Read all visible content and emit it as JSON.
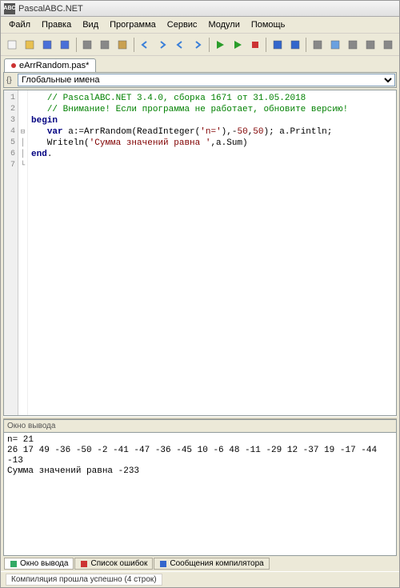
{
  "app": {
    "title": "PascalABC.NET",
    "icon_label": "ABC"
  },
  "menu": [
    "Файл",
    "Правка",
    "Вид",
    "Программа",
    "Сервис",
    "Модули",
    "Помощь"
  ],
  "tab": {
    "label": "eArrRandom.pas*"
  },
  "dropdown": {
    "selected": "Глобальные имена"
  },
  "code": {
    "line_count": 7,
    "lines": [
      {
        "n": 1,
        "fold": "",
        "segs": [
          {
            "t": "   ",
            "c": ""
          },
          {
            "t": "// PascalABC.NET 3.4.0, сборка 1671 от 31.05.2018",
            "c": "c-comment"
          }
        ]
      },
      {
        "n": 2,
        "fold": "",
        "segs": [
          {
            "t": "   ",
            "c": ""
          },
          {
            "t": "// Внимание! Если программа не работает, обновите версию!",
            "c": "c-comment"
          }
        ]
      },
      {
        "n": 3,
        "fold": "",
        "segs": [
          {
            "t": "",
            "c": ""
          }
        ]
      },
      {
        "n": 4,
        "fold": "⊟",
        "segs": [
          {
            "t": "begin",
            "c": "c-key"
          }
        ]
      },
      {
        "n": 5,
        "fold": "│",
        "segs": [
          {
            "t": "   ",
            "c": ""
          },
          {
            "t": "var",
            "c": "c-key"
          },
          {
            "t": " a:=ArrRandom(ReadInteger(",
            "c": ""
          },
          {
            "t": "'n='",
            "c": "c-str"
          },
          {
            "t": "),-",
            "c": ""
          },
          {
            "t": "50",
            "c": "c-num"
          },
          {
            "t": ",",
            "c": ""
          },
          {
            "t": "50",
            "c": "c-num"
          },
          {
            "t": "); a.Println;",
            "c": ""
          }
        ]
      },
      {
        "n": 6,
        "fold": "│",
        "segs": [
          {
            "t": "   Writeln(",
            "c": ""
          },
          {
            "t": "'Сумма значений равна '",
            "c": "c-str"
          },
          {
            "t": ",a.Sum)",
            "c": ""
          }
        ]
      },
      {
        "n": 7,
        "fold": "└",
        "segs": [
          {
            "t": "end",
            "c": "c-key"
          },
          {
            "t": ".",
            "c": ""
          }
        ]
      }
    ]
  },
  "output": {
    "title": "Окно вывода",
    "text": "n= 21\n26 17 49 -36 -50 -2 -41 -47 -36 -45 10 -6 48 -11 -29 12 -37 19 -17 -44 -13 \nСумма значений равна -233"
  },
  "bottom_tabs": [
    {
      "label": "Окно вывода",
      "active": true,
      "color": "#3a6"
    },
    {
      "label": "Список ошибок",
      "active": false,
      "color": "#c33"
    },
    {
      "label": "Сообщения компилятора",
      "active": false,
      "color": "#36c"
    }
  ],
  "status": "Компиляция прошла успешно (4 строк)",
  "toolbar_icons": [
    "new-file-icon",
    "open-file-icon",
    "save-icon",
    "save-all-icon",
    "sep",
    "cut-icon",
    "copy-icon",
    "paste-icon",
    "sep",
    "undo-icon",
    "redo-icon",
    "back-icon",
    "forward-icon",
    "sep",
    "run-icon",
    "run-no-debug-icon",
    "stop-icon",
    "sep",
    "step-into-icon",
    "step-over-icon",
    "sep",
    "toggle-output-icon",
    "toggle-form-icon",
    "toggle-design-icon",
    "toggle-panel1-icon",
    "toggle-panel2-icon"
  ]
}
